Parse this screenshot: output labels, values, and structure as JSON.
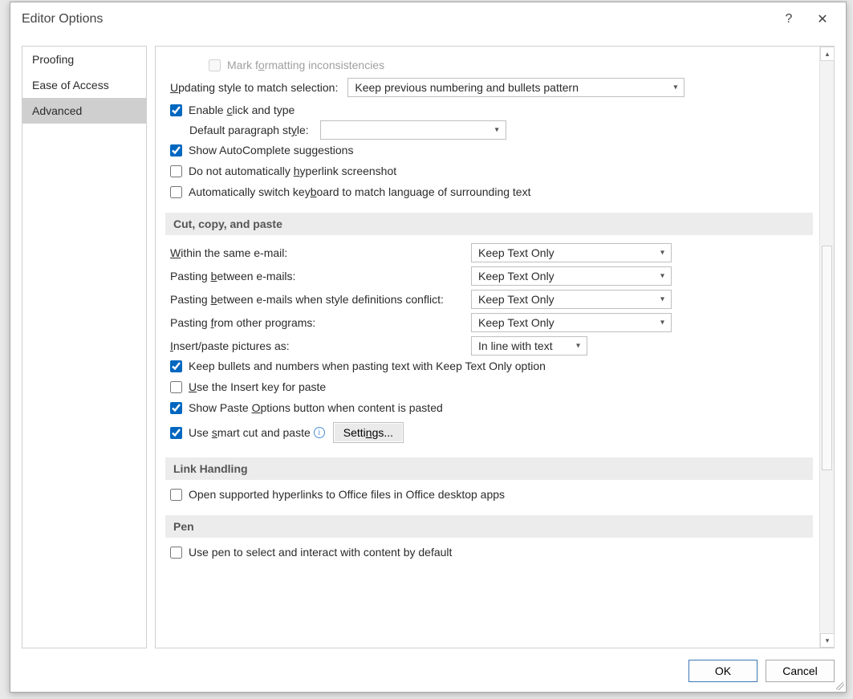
{
  "dialog_title": "Editor Options",
  "sidebar": [
    {
      "label": "Proofing",
      "selected": false
    },
    {
      "label": "Ease of Access",
      "selected": false
    },
    {
      "label": "Advanced",
      "selected": true
    }
  ],
  "editing": {
    "mark_formatting_inconsistencies": "Mark formatting inconsistencies",
    "updating_style_label": "Updating style to match selection:",
    "updating_style_value": "Keep previous numbering and bullets pattern",
    "enable_click_and_type": "Enable click and type",
    "default_paragraph_style_label": "Default paragraph style:",
    "default_paragraph_style_value": "",
    "show_autocomplete": "Show AutoComplete suggestions",
    "no_auto_hyperlink": "Do not automatically hyperlink screenshot",
    "auto_switch_keyboard": "Automatically switch keyboard to match language of surrounding text"
  },
  "cut_copy_paste": {
    "header": "Cut, copy, and paste",
    "within_same_email": "Within the same e-mail:",
    "between_emails": "Pasting between e-mails:",
    "between_conflict": "Pasting between e-mails when style definitions conflict:",
    "from_other": "Pasting from other programs:",
    "insert_pictures": "Insert/paste pictures as:",
    "within_same_value": "Keep Text Only",
    "between_value": "Keep Text Only",
    "conflict_value": "Keep Text Only",
    "from_other_value": "Keep Text Only",
    "pictures_value": "In line with text",
    "keep_bullets": "Keep bullets and numbers when pasting text with Keep Text Only option",
    "use_insert_key": "Use the Insert key for paste",
    "show_paste_options": "Show Paste Options button when content is pasted",
    "smart_cut_paste": "Use smart cut and paste",
    "settings_btn": "Settings..."
  },
  "link_handling": {
    "header": "Link Handling",
    "open_office_hyperlinks": "Open supported hyperlinks to Office files in Office desktop apps"
  },
  "pen": {
    "header": "Pen",
    "use_pen": "Use pen to select and interact with content by default"
  },
  "buttons": {
    "ok": "OK",
    "cancel": "Cancel"
  }
}
